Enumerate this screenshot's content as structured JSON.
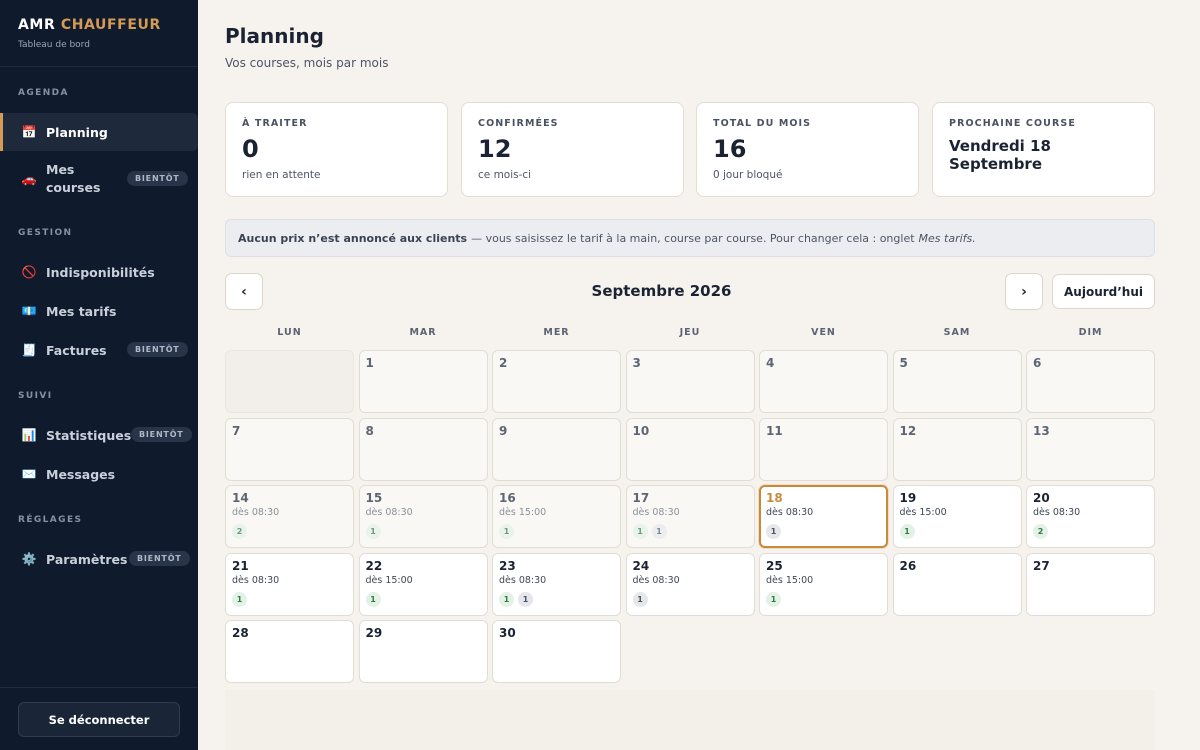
{
  "brand": {
    "name": "AMR",
    "accent": "CHAUFFEUR",
    "subtitle": "Tableau de bord"
  },
  "sidebar": {
    "sections": [
      {
        "label": "AGENDA"
      },
      {
        "label": "GESTION"
      },
      {
        "label": "SUIVI"
      },
      {
        "label": "RÉGLAGES"
      }
    ],
    "items": [
      {
        "label": "Planning",
        "icon": "calendar-icon",
        "glyph": "📅",
        "badge": ""
      },
      {
        "label": "Mes courses",
        "icon": "car-icon",
        "glyph": "🚗",
        "badge": "BIENTÔT"
      },
      {
        "label": "Indisponibilités",
        "icon": "prohibited-icon",
        "glyph": "🚫",
        "badge": ""
      },
      {
        "label": "Mes tarifs",
        "icon": "banknote-icon",
        "glyph": "💶",
        "badge": ""
      },
      {
        "label": "Factures",
        "icon": "receipt-icon",
        "glyph": "🧾",
        "badge": "BIENTÔT"
      },
      {
        "label": "Statistiques",
        "icon": "bar-chart-icon",
        "glyph": "📊",
        "badge": "BIENTÔT"
      },
      {
        "label": "Messages",
        "icon": "envelope-icon",
        "glyph": "✉️",
        "badge": ""
      },
      {
        "label": "Paramètres",
        "icon": "gear-icon",
        "glyph": "⚙️",
        "badge": "BIENTÔT"
      }
    ],
    "logout_label": "Se déconnecter"
  },
  "page": {
    "title": "Planning",
    "subtitle": "Vos courses, mois par mois"
  },
  "stats": [
    {
      "label": "À TRAITER",
      "value": "0",
      "note": "rien en attente"
    },
    {
      "label": "CONFIRMÉES",
      "value": "12",
      "note": "ce mois-ci"
    },
    {
      "label": "TOTAL DU MOIS",
      "value": "16",
      "note": "0 jour bloqué"
    },
    {
      "label": "PROCHAINE COURSE",
      "value": "Vendredi 18 Septembre",
      "note": ""
    }
  ],
  "banner": {
    "bold": "Aucun prix n’est annoncé aux clients",
    "text": "— vous saisissez le tarif à la main, course par course. Pour changer cela : onglet",
    "italic": "Mes tarifs."
  },
  "calendar": {
    "month_label": "Septembre 2026",
    "prev_glyph": "‹",
    "next_glyph": "›",
    "today_label": "Aujourd’hui",
    "weekdays": [
      "LUN",
      "MAR",
      "MER",
      "JEU",
      "VEN",
      "SAM",
      "DIM"
    ],
    "days": [
      {
        "n": "",
        "state": "empty",
        "time": "",
        "pills": []
      },
      {
        "n": "1",
        "state": "past",
        "time": "",
        "pills": []
      },
      {
        "n": "2",
        "state": "past",
        "time": "",
        "pills": []
      },
      {
        "n": "3",
        "state": "past",
        "time": "",
        "pills": []
      },
      {
        "n": "4",
        "state": "past",
        "time": "",
        "pills": []
      },
      {
        "n": "5",
        "state": "past",
        "time": "",
        "pills": []
      },
      {
        "n": "6",
        "state": "past",
        "time": "",
        "pills": []
      },
      {
        "n": "7",
        "state": "past",
        "time": "",
        "pills": []
      },
      {
        "n": "8",
        "state": "past",
        "time": "",
        "pills": []
      },
      {
        "n": "9",
        "state": "past",
        "time": "",
        "pills": []
      },
      {
        "n": "10",
        "state": "past",
        "time": "",
        "pills": []
      },
      {
        "n": "11",
        "state": "past",
        "time": "",
        "pills": []
      },
      {
        "n": "12",
        "state": "past",
        "time": "",
        "pills": []
      },
      {
        "n": "13",
        "state": "past",
        "time": "",
        "pills": []
      },
      {
        "n": "14",
        "state": "past",
        "time": "dès 08:30",
        "pills": [
          {
            "v": "2",
            "c": "green"
          }
        ]
      },
      {
        "n": "15",
        "state": "past",
        "time": "dès 08:30",
        "pills": [
          {
            "v": "1",
            "c": "green"
          }
        ]
      },
      {
        "n": "16",
        "state": "past",
        "time": "dès 15:00",
        "pills": [
          {
            "v": "1",
            "c": "green"
          }
        ]
      },
      {
        "n": "17",
        "state": "past",
        "time": "dès 08:30",
        "pills": [
          {
            "v": "1",
            "c": "green"
          },
          {
            "v": "1",
            "c": "grey"
          }
        ]
      },
      {
        "n": "18",
        "state": "today",
        "time": "dès 08:30",
        "pills": [
          {
            "v": "1",
            "c": "grey"
          }
        ]
      },
      {
        "n": "19",
        "state": "future",
        "time": "dès 15:00",
        "pills": [
          {
            "v": "1",
            "c": "green"
          }
        ]
      },
      {
        "n": "20",
        "state": "future",
        "time": "dès 08:30",
        "pills": [
          {
            "v": "2",
            "c": "green"
          }
        ]
      },
      {
        "n": "21",
        "state": "future",
        "time": "dès 08:30",
        "pills": [
          {
            "v": "1",
            "c": "green"
          }
        ]
      },
      {
        "n": "22",
        "state": "future",
        "time": "dès 15:00",
        "pills": [
          {
            "v": "1",
            "c": "green"
          }
        ]
      },
      {
        "n": "23",
        "state": "future",
        "time": "dès 08:30",
        "pills": [
          {
            "v": "1",
            "c": "green"
          },
          {
            "v": "1",
            "c": "grey"
          }
        ]
      },
      {
        "n": "24",
        "state": "future",
        "time": "dès 08:30",
        "pills": [
          {
            "v": "1",
            "c": "grey"
          }
        ]
      },
      {
        "n": "25",
        "state": "future",
        "time": "dès 15:00",
        "pills": [
          {
            "v": "1",
            "c": "green"
          }
        ]
      },
      {
        "n": "26",
        "state": "future",
        "time": "",
        "pills": []
      },
      {
        "n": "27",
        "state": "future",
        "time": "",
        "pills": []
      },
      {
        "n": "28",
        "state": "future",
        "time": "",
        "pills": []
      },
      {
        "n": "29",
        "state": "future",
        "time": "",
        "pills": []
      },
      {
        "n": "30",
        "state": "future",
        "time": "",
        "pills": []
      }
    ]
  },
  "colors": {
    "sidebar_bg": "#0f1b2d",
    "accent": "#d59a54",
    "page_bg": "#f6f3ee",
    "today_border": "#c98a3e",
    "pill_green": "#2f7d45"
  }
}
